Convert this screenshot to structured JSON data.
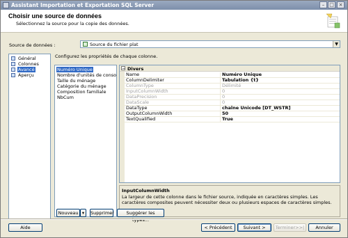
{
  "window": {
    "title": "Assistant Importation et Exportation SQL Server",
    "controls": {
      "minimize": "–",
      "maximize": "□",
      "close": "×"
    }
  },
  "header": {
    "title": "Choisir une source de données",
    "subtitle": "Sélectionnez la source pour la copie des données."
  },
  "datasource": {
    "label": "Source de données :",
    "value": "Source du fichier plat",
    "arrow": "▼"
  },
  "nav": {
    "items": [
      {
        "label": "Général",
        "icon": "general-icon",
        "selected": false
      },
      {
        "label": "Colonnes",
        "icon": "columns-icon",
        "selected": false
      },
      {
        "label": "Avancé",
        "icon": "advanced-icon",
        "selected": true
      },
      {
        "label": "Aperçu",
        "icon": "preview-icon",
        "selected": false
      }
    ]
  },
  "main": {
    "instruction": "Configurez les propriétés de chaque colonne.",
    "columns": [
      "Numéro Unique",
      "Nombre d'unités de consommation",
      "Taille du ménage",
      "Catégorie du ménage",
      "Composition familiale",
      "NbCum"
    ],
    "selected_column_index": 0
  },
  "propgrid": {
    "category": "Divers",
    "toggle": "−",
    "rows": [
      {
        "name": "Name",
        "value": "Numéro Unique",
        "bold": true,
        "disabled": false
      },
      {
        "name": "ColumnDelimiter",
        "value": "Tabulation {t}",
        "bold": true,
        "disabled": false
      },
      {
        "name": "ColumnType",
        "value": "Délimité",
        "bold": false,
        "disabled": true
      },
      {
        "name": "InputColumnWidth",
        "value": "0",
        "bold": false,
        "disabled": true
      },
      {
        "name": "DataPrecision",
        "value": "0",
        "bold": false,
        "disabled": true
      },
      {
        "name": "DataScale",
        "value": "0",
        "bold": false,
        "disabled": true
      },
      {
        "name": "DataType",
        "value": "chaîne Unicode [DT_WSTR]",
        "bold": true,
        "disabled": false
      },
      {
        "name": "OutputColumnWidth",
        "value": "50",
        "bold": true,
        "disabled": false
      },
      {
        "name": "TextQualified",
        "value": "True",
        "bold": true,
        "disabled": false
      }
    ]
  },
  "description": {
    "title": "InputColumnWidth",
    "text": "La largeur de cette colonne dans le fichier source, indiquée en caractères simples. Les caractères composites peuvent nécessiter deux ou plusieurs espaces de caractères simples."
  },
  "buttons": {
    "new": "Nouveau",
    "new_arrow": "▾",
    "delete": "Supprimer",
    "suggest": "Suggérer les types...",
    "help": "Aide",
    "previous": "< Précédent",
    "next": "Suivant >",
    "finish": "Terminer>>|",
    "cancel": "Annuler"
  }
}
